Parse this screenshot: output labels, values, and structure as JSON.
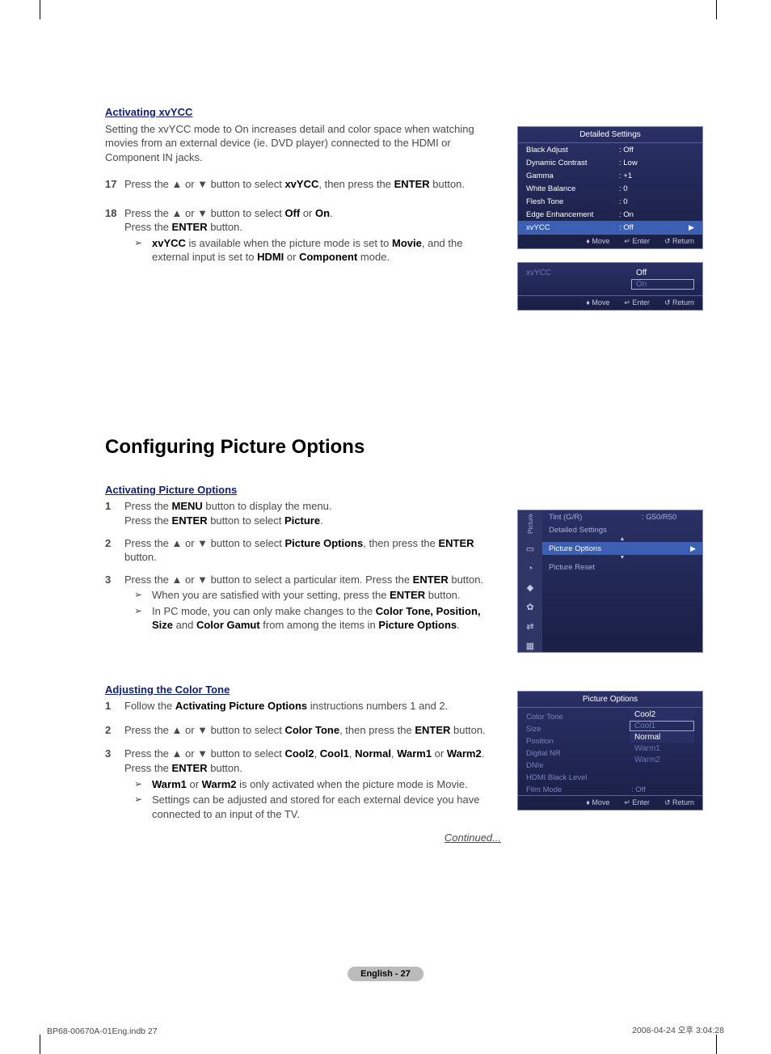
{
  "section1": {
    "title": "Activating xvYCC",
    "intro": "Setting the xvYCC mode to On increases detail and color space when watching movies from an external device (ie. DVD player) connected to the HDMI or Component IN jacks.",
    "step17_num": "17",
    "step17_a": "Press the ▲ or ▼ button to select ",
    "step17_b": "xvYCC",
    "step17_c": ", then press the ",
    "step17_d": "ENTER",
    "step17_e": " button.",
    "step18_num": "18",
    "step18_a": "Press the ▲ or ▼ button to select ",
    "step18_b": "Off",
    "step18_c": " or ",
    "step18_d": "On",
    "step18_e": ".",
    "step18_f": "Press the ",
    "step18_g": "ENTER",
    "step18_h": " button.",
    "note_a": "xvYCC",
    "note_b": " is available when the picture mode is set to ",
    "note_c": "Movie",
    "note_d": ", and the external input is set to ",
    "note_e": "HDMI",
    "note_f": " or ",
    "note_g": "Component",
    "note_h": " mode."
  },
  "heading2": "Configuring Picture Options",
  "section2": {
    "title": "Activating Picture Options",
    "s1_num": "1",
    "s1_a": "Press the ",
    "s1_b": "MENU",
    "s1_c": " button to display the menu.",
    "s1_d": "Press the ",
    "s1_e": "ENTER",
    "s1_f": " button to select ",
    "s1_g": "Picture",
    "s1_h": ".",
    "s2_num": "2",
    "s2_a": "Press the ▲ or ▼ button to select ",
    "s2_b": "Picture Options",
    "s2_c": ", then press the ",
    "s2_d": "ENTER",
    "s2_e": " button.",
    "s3_num": "3",
    "s3_a": "Press the ▲ or ▼ button to select a particular item. Press the ",
    "s3_b": "ENTER",
    "s3_c": " button.",
    "n1_a": "When you are satisfied with your setting, press the ",
    "n1_b": "ENTER",
    "n1_c": " button.",
    "n2_a": "In PC mode, you can only make changes to the ",
    "n2_b": "Color Tone, Position, Size",
    "n2_c": " and ",
    "n2_d": "Color Gamut",
    "n2_e": " from among the items in ",
    "n2_f": "Picture Options",
    "n2_g": "."
  },
  "section3": {
    "title": "Adjusting the Color Tone",
    "s1_num": "1",
    "s1_a": "Follow the ",
    "s1_b": "Activating Picture Options",
    "s1_c": " instructions numbers 1 and 2.",
    "s2_num": "2",
    "s2_a": "Press the ▲ or ▼ button to select ",
    "s2_b": "Color Tone",
    "s2_c": ", then press the ",
    "s2_d": "ENTER",
    "s2_e": " button.",
    "s3_num": "3",
    "s3_a": "Press the ▲ or ▼ button to select ",
    "s3_b": "Cool2",
    "s3_c": ", ",
    "s3_d": "Cool1",
    "s3_e": ", ",
    "s3_f": "Normal",
    "s3_g": ", ",
    "s3_h": "Warm1",
    "s3_i": " or ",
    "s3_j": "Warm2",
    "s3_k": ".",
    "s3_l": "Press the ",
    "s3_m": "ENTER",
    "s3_n": " button.",
    "n1_a": "Warm1",
    "n1_b": " or ",
    "n1_c": "Warm2",
    "n1_d": " is only activated when the picture mode is Movie.",
    "n2": "Settings can be adjusted and stored for each external device you have connected to an input of the TV."
  },
  "continued": "Continued...",
  "pagenum": "English - 27",
  "footer_left": "BP68-00670A-01Eng.indb   27",
  "footer_right": "2008-04-24   오후 3:04:28",
  "osd1": {
    "title": "Detailed Settings",
    "rows": [
      {
        "label": "Black Adjust",
        "value": ": Off"
      },
      {
        "label": "Dynamic Contrast",
        "value": ": Low"
      },
      {
        "label": "Gamma",
        "value": ": +1"
      },
      {
        "label": "White Balance",
        "value": ": 0"
      },
      {
        "label": "Flesh Tone",
        "value": ": 0"
      },
      {
        "label": "Edge Enhancement",
        "value": ": On"
      },
      {
        "label": "xvYCC",
        "value": ": Off",
        "highlight": true,
        "arrow": "▶"
      }
    ],
    "footer_move": "Move",
    "footer_enter": "Enter",
    "footer_return": "Return"
  },
  "osd2": {
    "label": "xvYCC",
    "opt_off": "Off",
    "opt_on": "On",
    "footer_move": "Move",
    "footer_enter": "Enter",
    "footer_return": "Return"
  },
  "osd3": {
    "side_label": "Picture",
    "tint_label": "Tint (G/R)",
    "tint_value": ": G50/R50",
    "detailed": "Detailed Settings",
    "picture_options": "Picture Options",
    "picture_reset": "Picture Reset"
  },
  "osd4": {
    "title": "Picture Options",
    "rows_left": [
      "Color Tone",
      "Size",
      "Position",
      "Digital NR",
      "DNIe",
      "HDMI Black Level",
      "Film Mode"
    ],
    "film_mode_val": ": Off",
    "opts": [
      "Cool2",
      "Cool1",
      "Normal",
      "Warm1",
      "Warm2"
    ],
    "footer_move": "Move",
    "footer_enter": "Enter",
    "footer_return": "Return"
  }
}
